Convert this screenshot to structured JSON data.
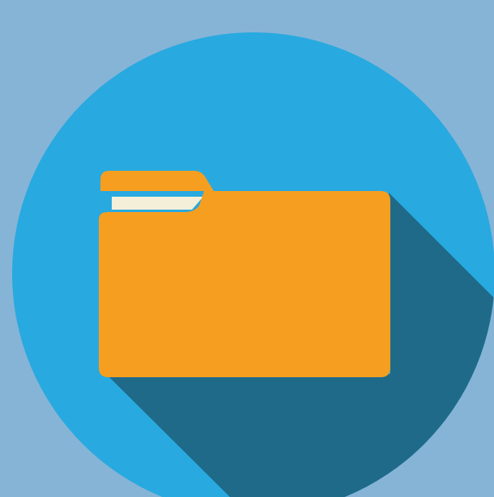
{
  "icon": {
    "name": "folder-icon",
    "colors": {
      "background": "#85b4d6",
      "circle": "#28a9e0",
      "long_shadow": "#1e6a88",
      "folder_body": "#f59e1f",
      "folder_tab": "#f59e1f",
      "paper": "#f3efd8"
    }
  }
}
